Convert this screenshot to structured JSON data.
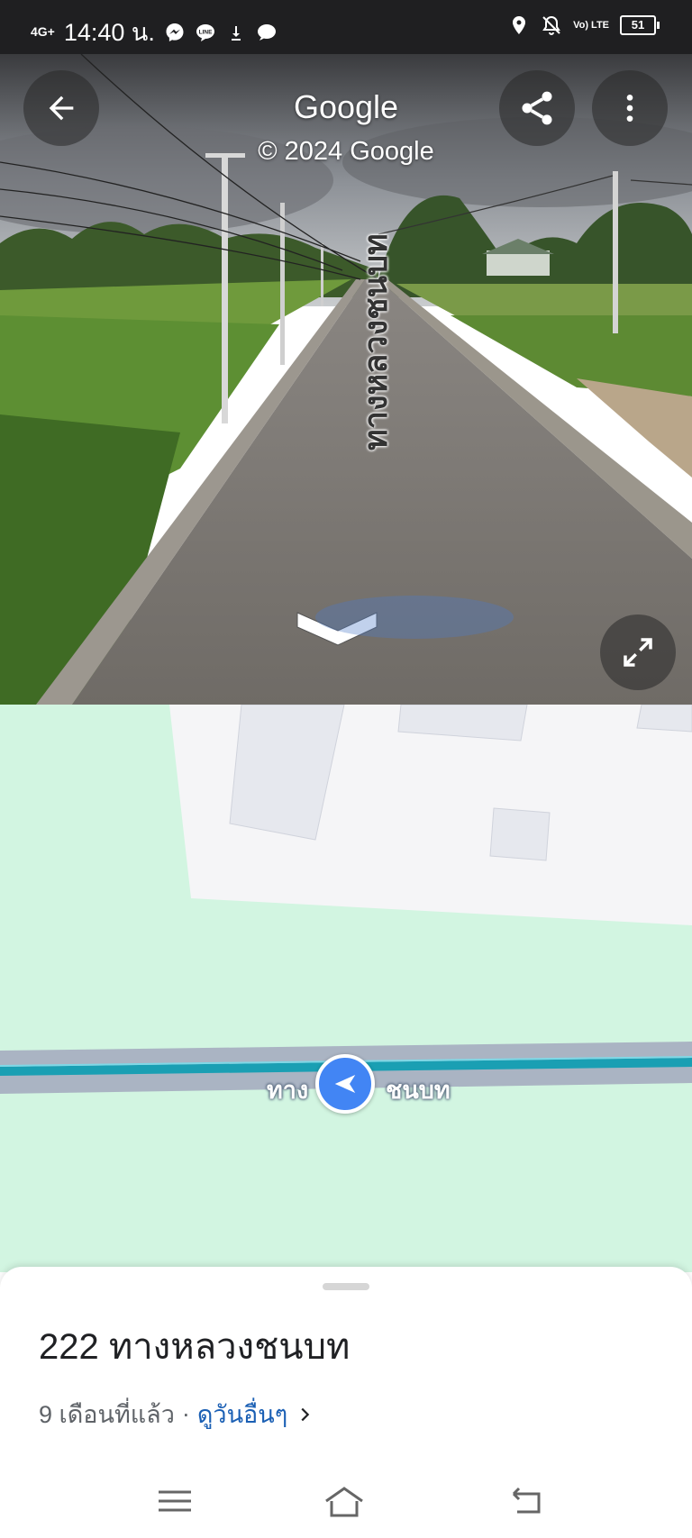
{
  "status_bar": {
    "network": "4G+",
    "time": "14:40 น.",
    "battery": "51",
    "volte": "Vo) LTE",
    "notification_icons": [
      "messenger-icon",
      "line-icon",
      "download-icon",
      "chat-bubble-icon"
    ],
    "system_icons": [
      "location-icon",
      "mute-icon",
      "volte-icon",
      "battery-icon"
    ]
  },
  "street_view": {
    "brand": "Google",
    "copyright": "© 2024 Google",
    "road_label": "ทางหลวงชนบท"
  },
  "map": {
    "road_label_left": "ทาง",
    "road_label_right": "ชนบท",
    "colors": {
      "land": "#d2f5e1",
      "road": "#aab4c3",
      "route": "#1a9fb3",
      "pointer": "#4285f4"
    }
  },
  "place": {
    "title": "222 ทางหลวงชนบท",
    "date": "9 เดือนที่แล้ว",
    "separator": "·",
    "see_more": "ดูวันอื่นๆ"
  }
}
